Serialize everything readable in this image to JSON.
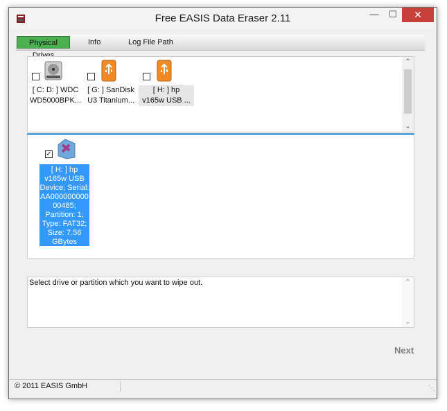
{
  "window": {
    "title": "Free EASIS Data Eraser 2.11"
  },
  "controls": {
    "minimize": "—",
    "maximize": "☐",
    "close": "✕"
  },
  "tabs": [
    {
      "label": "Physical Drives",
      "active": true
    },
    {
      "label": "Info"
    },
    {
      "label": "Log File Path"
    }
  ],
  "drives": [
    {
      "icon": "hard-drive-icon",
      "label_line1": "[ C: D: ] WDC",
      "label_line2": "WD5000BPK...",
      "checked": false
    },
    {
      "icon": "usb-drive-icon",
      "label_line1": "[ G: ] SanDisk",
      "label_line2": "U3 Titanium...",
      "checked": false
    },
    {
      "icon": "usb-drive-icon",
      "label_line1": "[ H: ] hp",
      "label_line2": "v165w USB ...",
      "checked": false
    }
  ],
  "partition": {
    "checked": true,
    "check_mark": "✓",
    "lines": [
      "[ H: ] hp",
      "v165w USB",
      "Device; Serial:",
      "AA000000000",
      "00485;",
      "Partition: 1;",
      "Type: FAT32;",
      "Size: 7.56",
      "GBytes"
    ]
  },
  "message": "Select drive or partition which you want to wipe out.",
  "next_label": "Next",
  "status": {
    "copyright": "© 2011 EASIS GmbH"
  },
  "colors": {
    "active_tab": "#4caf50",
    "selection": "#3399ff",
    "close_button": "#c7413b"
  }
}
